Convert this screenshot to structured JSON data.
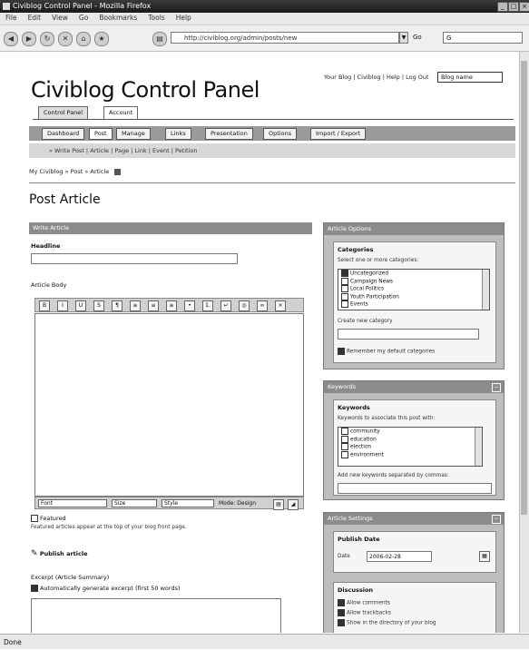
{
  "window": {
    "title": "Civiblog Control Panel - Mozilla Firefox"
  },
  "menu": [
    "File",
    "Edit",
    "View",
    "Go",
    "Bookmarks",
    "Tools",
    "Help"
  ],
  "address": {
    "url": "http://civiblog.org/admin/posts/new"
  },
  "toolbar": {
    "go_label": "Go"
  },
  "status": {
    "text": "Done"
  },
  "site": {
    "title": "Civiblog Control Panel",
    "top_links": "Your Blog | Civiblog | Help | Log Out",
    "blog_select": "Blog name"
  },
  "tabs1": [
    "Control Panel",
    "Account"
  ],
  "tabs2": [
    "Dashboard",
    "Post",
    "Manage",
    "Links",
    "Presentation",
    "Options",
    "Import / Export"
  ],
  "sublinks": "» Write Post | Article | Page | Link | Event | Petition",
  "breadcrumb": "My Civiblog » Post » Article",
  "page_title": "Post Article",
  "article": {
    "panel_head": "Write Article",
    "title_label": "Headline",
    "body_label": "Article Body",
    "editor_buttons": [
      "B",
      "I",
      "U",
      "S",
      "¶",
      "≡",
      "≡",
      "≡",
      "•",
      "1.",
      "↵",
      "◎",
      "∞",
      "×"
    ],
    "format_selects": [
      "Font",
      "Size",
      "Style"
    ],
    "mode_label": "Mode: Design",
    "flag_label": "Featured",
    "flag_note": "Featured articles appear at the top of your blog front page.",
    "publish_label": "Publish article",
    "excerpt_label": "Excerpt (Article Summary)",
    "excerpt_option": "Automatically generate excerpt (first 50 words)"
  },
  "sidebar": {
    "options": {
      "head": "Article Options",
      "categories_label": "Categories",
      "categories_hint": "Select one or more categories:",
      "categories": [
        "Uncategorized",
        "Campaign News",
        "Local Politics",
        "Youth Participation",
        "Events"
      ],
      "new_cat_label": "Create new category",
      "remember_label": "Remember my default categories"
    },
    "keywords": {
      "head": "Keywords",
      "label": "Keywords",
      "hint": "Keywords to associate this post with:",
      "items": [
        "community",
        "education",
        "election",
        "environment"
      ],
      "other_label": "Add new keywords separated by commas:"
    },
    "settings": {
      "head": "Article Settings",
      "date_label": "Publish Date",
      "date_prefix": "Date",
      "date_value": "2006-02-28",
      "discussion_label": "Discussion",
      "discussion": [
        "Allow comments",
        "Allow trackbacks",
        "Show in the directory of your blog"
      ]
    }
  }
}
